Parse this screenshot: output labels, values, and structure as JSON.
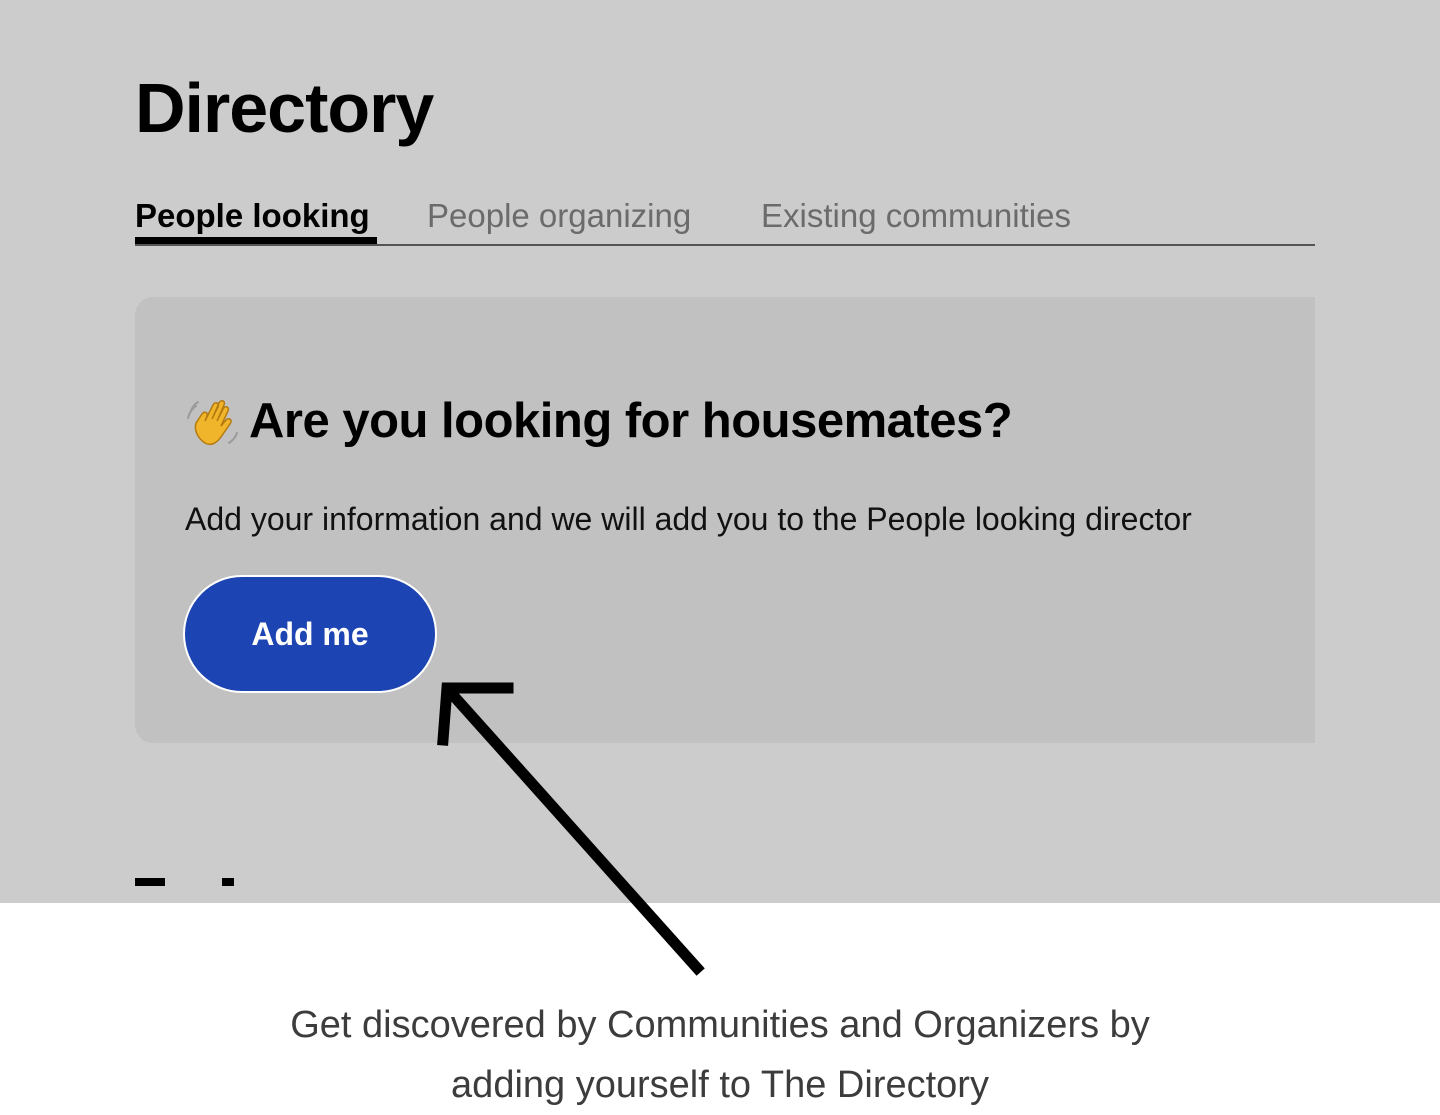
{
  "page": {
    "title": "Directory"
  },
  "tabs": [
    {
      "label": "People looking",
      "active": true
    },
    {
      "label": "People organizing",
      "active": false
    },
    {
      "label": "Existing communities",
      "active": false
    }
  ],
  "card": {
    "icon": "waving-hand-icon",
    "heading": "Are you looking for housemates?",
    "body": "Add your information and we will add you to the People looking director",
    "button_label": "Add me"
  },
  "caption": {
    "line1": "Get discovered by Communities and Organizers by",
    "line2": "adding yourself to The Directory"
  },
  "colors": {
    "screen_background": "#cccccc",
    "card_background": "#c1c1c1",
    "button": "#1c44b2",
    "caption_text": "#3c3c3c"
  }
}
